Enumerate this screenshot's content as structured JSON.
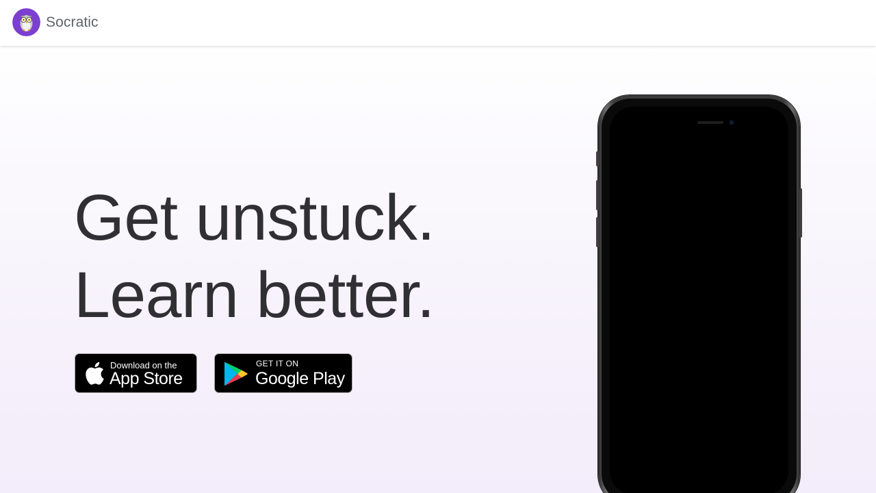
{
  "header": {
    "brand_name": "Socratic",
    "logo_icon": "owl-logo-icon"
  },
  "hero": {
    "headline_line1": "Get unstuck.",
    "headline_line2": "Learn better."
  },
  "badges": {
    "app_store": {
      "small_text": "Download on the",
      "big_text": "App Store",
      "icon": "apple-icon"
    },
    "google_play": {
      "small_text": "GET IT ON",
      "big_text": "Google Play",
      "icon": "google-play-icon"
    }
  },
  "colors": {
    "brand_purple": "#7c3fd0",
    "headline": "#303034",
    "background_top": "#ffffff",
    "background_bottom": "#f3ecfa"
  }
}
